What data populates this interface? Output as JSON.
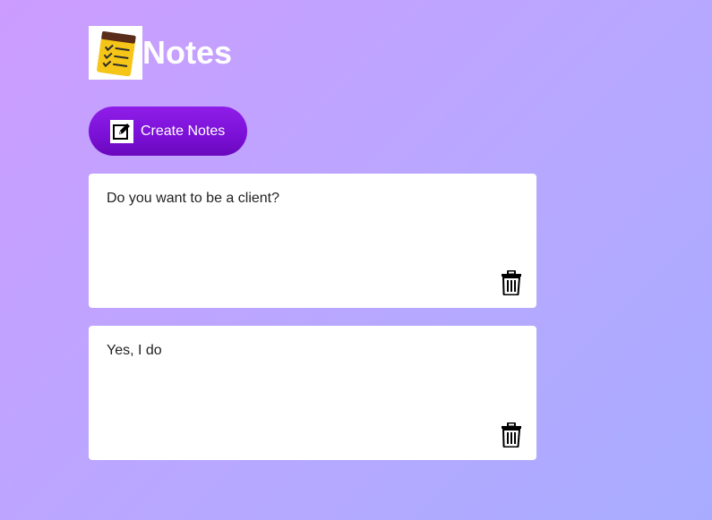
{
  "app": {
    "title": "Notes",
    "logo_icon": "notepad-checklist-icon"
  },
  "toolbar": {
    "create_label": "Create Notes",
    "create_icon": "pencil-edit-icon"
  },
  "notes": [
    {
      "text": "Do you want to be a client?",
      "delete_icon": "trash-icon"
    },
    {
      "text": "Yes, I do",
      "delete_icon": "trash-icon"
    }
  ],
  "colors": {
    "accent": "#7a10d6",
    "background_start": "#cc9cff",
    "background_end": "#a8acff"
  }
}
